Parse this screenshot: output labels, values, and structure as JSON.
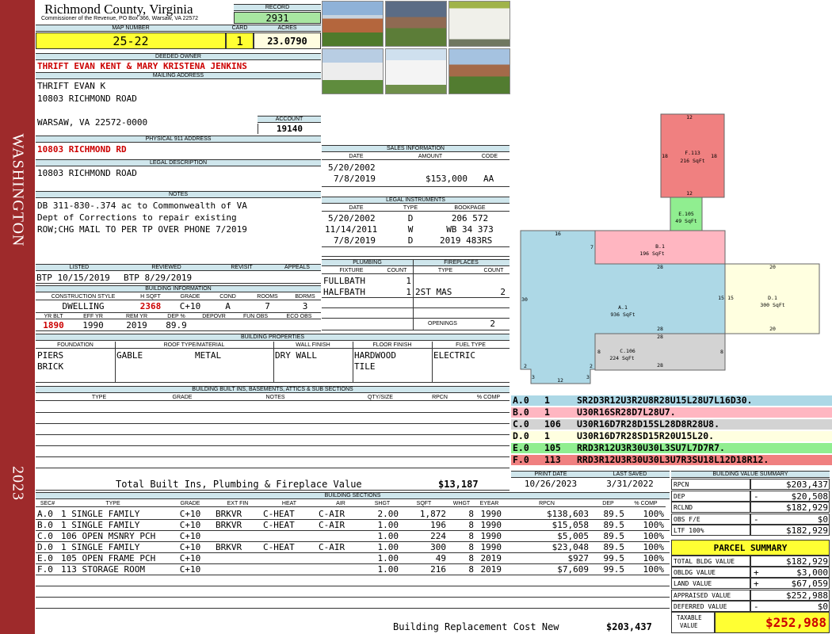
{
  "side": {
    "top": "WASHINGTON",
    "bottom": "2023"
  },
  "county": {
    "name": "Richmond County, Virginia",
    "sub": "Commissioner of the Revenue, PO Box 366, Warsaw, VA 22572"
  },
  "record": {
    "label": "RECORD",
    "value": "2931"
  },
  "map": {
    "label": "MAP NUMBER",
    "value": "25-22"
  },
  "card": {
    "label": "CARD",
    "value": "1"
  },
  "acres": {
    "label": "ACRES",
    "value": "23.0790"
  },
  "owner": {
    "label": "DEEDED OWNER",
    "value": "THRIFT EVAN KENT & MARY KRISTENA JENKINS"
  },
  "mailing": {
    "label": "MAILING ADDRESS",
    "line1": "THRIFT EVAN K",
    "line2": "10803 RICHMOND ROAD",
    "line3": "WARSAW, VA 22572-0000"
  },
  "account": {
    "label": "ACCOUNT",
    "value": "19140"
  },
  "physical": {
    "label": "PHYSICAL 911 ADDRESS",
    "value": "10803 RICHMOND RD"
  },
  "legal": {
    "label": "LEGAL DESCRIPTION",
    "value": "10803 RICHMOND ROAD"
  },
  "notes": {
    "label": "NOTES",
    "line1": "DB 311-830-.374 ac to Commonwealth of VA",
    "line2": "Dept of Corrections to repair existing",
    "line3": "ROW;CHG MAIL TO PER TP OVER PHONE 7/2019"
  },
  "dates": {
    "listed_label": "LISTED",
    "listed": "BTP 10/15/2019",
    "reviewed_label": "REVIEWED",
    "reviewed": "BTP  8/29/2019",
    "revisit_label": "REVISIT",
    "appeals_label": "APPEALS"
  },
  "bldg": {
    "label": "BUILDING INFORMATION",
    "h": [
      "CONSTRUCTION STYLE",
      "H SQFT",
      "GRADE",
      "COND",
      "ROOMS",
      "BDRMS"
    ],
    "style": "DWELLING",
    "hsqft": "2368",
    "grade": "C+10",
    "cond": "A",
    "rooms": "7",
    "bdrms": "3",
    "h2": [
      "YR BLT",
      "EFF YR",
      "REM YR",
      "DEP %",
      "DEPOVR",
      "FUN OBS",
      "ECO OBS"
    ],
    "yrblt": "1890",
    "effyr": "1990",
    "remyr": "2019",
    "dep": "89.9"
  },
  "sales": {
    "label": "SALES INFORMATION",
    "h": [
      "DATE",
      "AMOUNT",
      "CODE"
    ],
    "rows": [
      [
        "5/20/2002",
        "",
        ""
      ],
      [
        "7/8/2019",
        "$153,000",
        "AA"
      ]
    ]
  },
  "instr": {
    "label": "LEGAL INSTRUMENTS",
    "h": [
      "DATE",
      "TYPE",
      "BOOKPAGE"
    ],
    "rows": [
      [
        "5/20/2002",
        "D",
        "206 572"
      ],
      [
        "11/14/2011",
        "W",
        "WB 34 373"
      ],
      [
        "7/8/2019",
        "D",
        "2019 483RS"
      ]
    ]
  },
  "plumb": {
    "label": "PLUMBING",
    "h": [
      "FIXTURE",
      "COUNT"
    ],
    "rows": [
      [
        "FULLBATH",
        "1"
      ],
      [
        "HALFBATH",
        "1"
      ]
    ]
  },
  "fire": {
    "label": "FIREPLACES",
    "h": [
      "TYPE",
      "COUNT"
    ],
    "rows": [
      [
        "2ST MAS",
        "2"
      ]
    ],
    "openings_label": "OPENINGS",
    "openings": "2"
  },
  "props": {
    "label": "BUILDING PROPERTIES",
    "h": [
      "FOUNDATION",
      "ROOF TYPE/MATERIAL",
      "WALL FINISH",
      "FLOOR FINISH",
      "FUEL TYPE"
    ],
    "found1": "PIERS",
    "found2": "BRICK",
    "roof1": "GABLE",
    "roof2": "METAL",
    "wall": "DRY WALL",
    "floor1": "HARDWOOD",
    "floor2": "TILE",
    "fuel": "ELECTRIC"
  },
  "builtins": {
    "label": "BUILDING BUILT INS, BASEMENTS, ATTICS & SUB SECTIONS",
    "h": [
      "TYPE",
      "GRADE",
      "NOTES",
      "QTY/SIZE",
      "RPCN",
      "% COMP"
    ],
    "total_label": "Total Built Ins, Plumbing & Fireplace Value",
    "total": "$13,187"
  },
  "sketch": {
    "labels": [
      [
        "F.113",
        "216 SqFt"
      ],
      [
        "E.105",
        "49 SqFt"
      ],
      [
        "B.1",
        "196 SqFt"
      ],
      [
        "A.1",
        "936 SqFt"
      ],
      [
        "D.1",
        "300 SqFt"
      ],
      [
        "C.106",
        "224 SqFt"
      ]
    ],
    "dims": [
      "12",
      "18",
      "18",
      "12",
      "16",
      "7",
      "28",
      "30",
      "15",
      "15",
      "20",
      "20",
      "28",
      "28",
      "8",
      "8",
      "2",
      "2",
      "3",
      "12",
      "3",
      "28"
    ]
  },
  "codes": [
    {
      "id": "A.0",
      "n": "1",
      "code": "SR2D3R12U3R2U8R28U15L28U7L16D30.",
      "color": "#add8e6"
    },
    {
      "id": "B.0",
      "n": "1",
      "code": "U30R16SR28D7L28U7.",
      "color": "#ffb6c1"
    },
    {
      "id": "C.0",
      "n": "106",
      "code": "U30R16D7R28D15SL28D8R28U8.",
      "color": "#d3d3d3"
    },
    {
      "id": "D.0",
      "n": "1",
      "code": "U30R16D7R28SD15R20U15L20.",
      "color": "#ffffe0"
    },
    {
      "id": "E.0",
      "n": "105",
      "code": "RRD3R12U3R30U30L3SU7L7D7R7.",
      "color": "#90ee90"
    },
    {
      "id": "F.0",
      "n": "113",
      "code": "RRD3R12U3R30U30L3U7R3SU18L12D18R12.",
      "color": "#f08080"
    }
  ],
  "print": {
    "label": "PRINT DATE",
    "value": "10/26/2023",
    "saved_label": "LAST SAVED",
    "saved": "3/31/2022"
  },
  "bvs": {
    "label": "BUILDING VALUE SUMMARY",
    "rows": [
      [
        "RPCN",
        "",
        "$203,437"
      ],
      [
        "DEP",
        "-",
        "$20,508"
      ],
      [
        "RCLND",
        "",
        "$182,929"
      ],
      [
        "OBS F/E",
        "-",
        "$0"
      ],
      [
        "LTF   100%",
        "",
        "$182,929"
      ]
    ]
  },
  "parcel": {
    "label": "PARCEL SUMMARY",
    "rows": [
      [
        "TOTAL BLDG VALUE",
        "",
        "$182,929"
      ],
      [
        "OBLDG VALUE",
        "+",
        "$3,000"
      ],
      [
        "LAND VALUE",
        "+",
        "$67,059"
      ],
      [
        "APPRAISED VALUE",
        "",
        "$252,988"
      ],
      [
        "DEFERRED VALUE",
        "-",
        "$0"
      ]
    ],
    "taxable_label1": "TAXABLE",
    "taxable_label2": "VALUE",
    "taxable": "$252,988"
  },
  "sections": {
    "label": "BUILDING SECTIONS",
    "h": [
      "SEC#",
      "TYPE",
      "GRADE",
      "EXT FIN",
      "HEAT",
      "AIR",
      "SHGT",
      "SQFT",
      "WHGT",
      "EYEAR",
      "RPCN",
      "DEP",
      "% COMP"
    ],
    "rows": [
      [
        "A.0",
        "1 SINGLE FAMILY",
        "C+10",
        "BRKVR",
        "C-HEAT",
        "C-AIR",
        "2.00",
        "1,872",
        "8",
        "1990",
        "$138,603",
        "89.5",
        "100%"
      ],
      [
        "B.0",
        "1 SINGLE FAMILY",
        "C+10",
        "BRKVR",
        "C-HEAT",
        "C-AIR",
        "1.00",
        "196",
        "8",
        "1990",
        "$15,058",
        "89.5",
        "100%"
      ],
      [
        "C.0",
        "106 OPEN MSNRY PCH",
        "C+10",
        "",
        "",
        "",
        "1.00",
        "224",
        "8",
        "1990",
        "$5,005",
        "89.5",
        "100%"
      ],
      [
        "D.0",
        "1 SINGLE FAMILY",
        "C+10",
        "BRKVR",
        "C-HEAT",
        "C-AIR",
        "1.00",
        "300",
        "8",
        "1990",
        "$23,048",
        "89.5",
        "100%"
      ],
      [
        "E.0",
        "105 OPEN FRAME PCH",
        "C+10",
        "",
        "",
        "",
        "1.00",
        "49",
        "8",
        "2019",
        "$927",
        "99.5",
        "100%"
      ],
      [
        "F.0",
        "113 STORAGE ROOM",
        "C+10",
        "",
        "",
        "",
        "1.00",
        "216",
        "8",
        "2019",
        "$7,609",
        "99.5",
        "100%"
      ]
    ],
    "total_label": "Building Replacement Cost New",
    "total": "$203,437"
  }
}
